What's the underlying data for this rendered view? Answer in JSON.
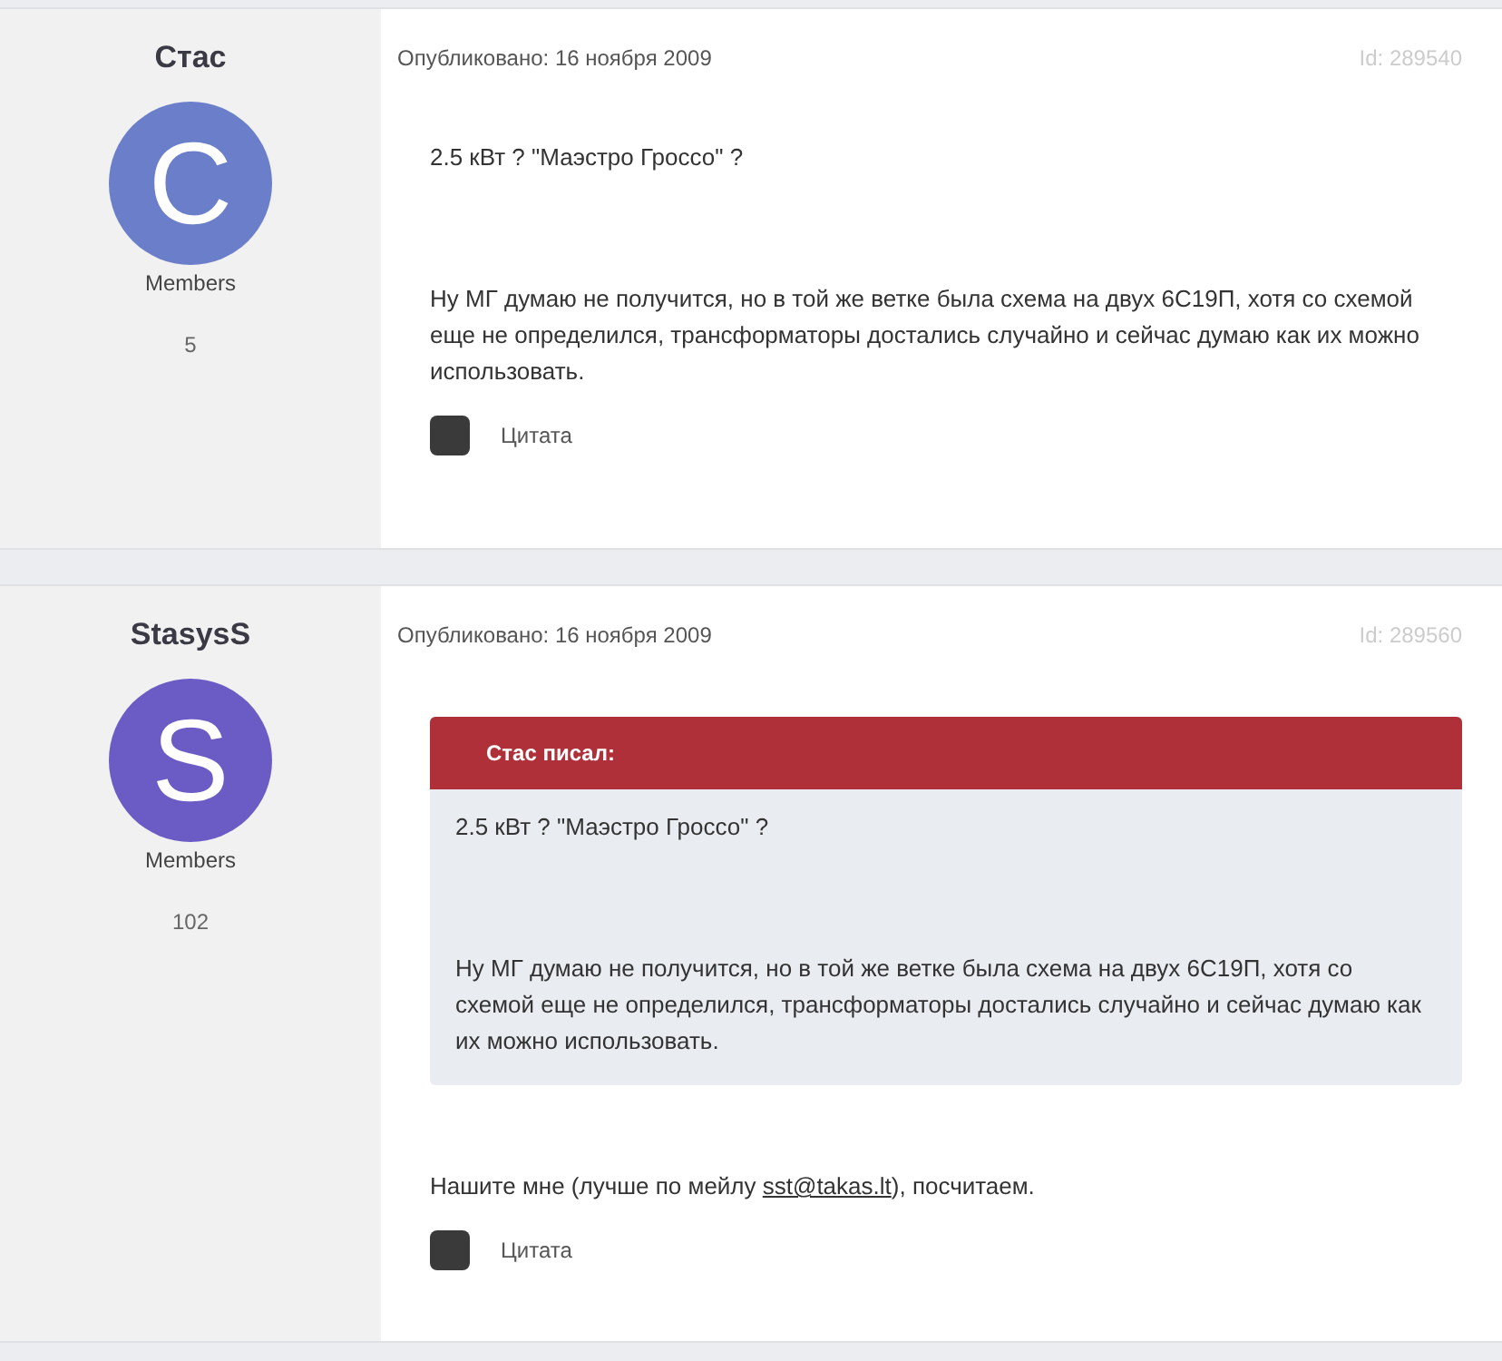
{
  "posts": [
    {
      "author": {
        "name": "Стас",
        "avatar_letter": "С",
        "color": "#6b7ec9",
        "group": "Members",
        "post_count": "5"
      },
      "published": "Опубликовано: 16 ноября 2009",
      "post_id": "Id: 289540",
      "paragraphs": [
        "2.5 кВт ? \"Маэстро Гроссо\" ?",
        "Ну МГ думаю не получится, но в той же ветке была схема на двух 6С19П, хотя со схемой еще не определился, трансформаторы достались случайно и сейчас думаю как их можно использовать."
      ],
      "quote_button": "Цитата"
    },
    {
      "author": {
        "name": "StasysS",
        "avatar_letter": "S",
        "color": "#6a5cc4",
        "group": "Members",
        "post_count": "102"
      },
      "published": "Опубликовано: 16 ноября 2009",
      "post_id": "Id: 289560",
      "quote": {
        "header": "Стас писал:",
        "paragraphs": [
          "2.5 кВт ? \"Маэстро Гроссо\" ?",
          "Ну МГ думаю не получится, но в той же ветке была схема на двух 6С19П, хотя со схемой еще не определился, трансформаторы достались случайно и сейчас думаю как их можно использовать."
        ]
      },
      "message": {
        "before": "Нашите мне (лучше по мейлу ",
        "link": "sst@takas.lt",
        "after": "), посчитаем."
      },
      "quote_button": "Цитата"
    }
  ]
}
